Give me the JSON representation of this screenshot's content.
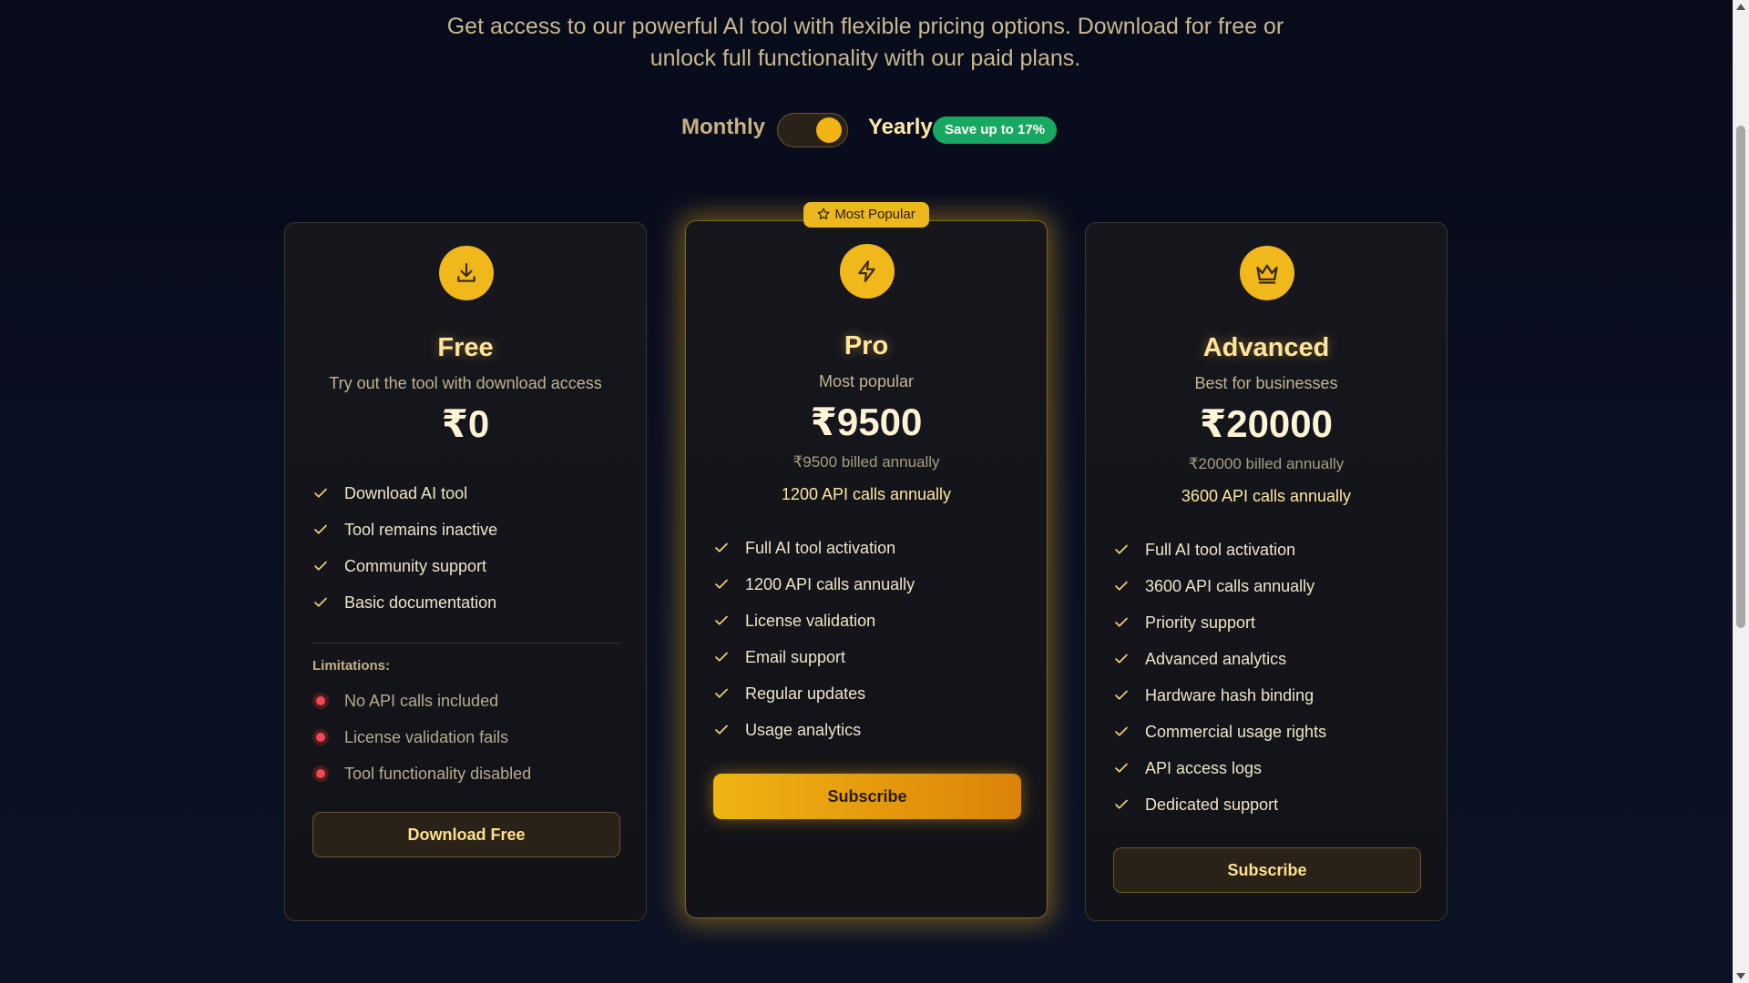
{
  "intro": {
    "line1": "Get access to our powerful AI tool with flexible pricing options. Download for free or",
    "line2": "unlock full functionality with our paid plans."
  },
  "billing": {
    "monthly_label": "Monthly",
    "yearly_label": "Yearly",
    "save_badge": "Save up to 17%",
    "selected": "Yearly"
  },
  "colors": {
    "accent": "#f0b81b",
    "success": "#19a861",
    "danger": "#ef4755"
  },
  "plans": {
    "free": {
      "icon": "download-icon",
      "name": "Free",
      "description": "Try out the tool with download access",
      "price": "₹0",
      "features": [
        "Download AI tool",
        "Tool remains inactive",
        "Community support",
        "Basic documentation"
      ],
      "limitations_title": "Limitations:",
      "limitations": [
        "No API calls included",
        "License validation fails",
        "Tool functionality disabled"
      ],
      "button": "Download Free"
    },
    "pro": {
      "badge": "Most Popular",
      "icon": "lightning-icon",
      "name": "Pro",
      "description": "Most popular",
      "price": "₹9500",
      "billed": "₹9500 billed annually",
      "calls": "1200 API calls annually",
      "features": [
        "Full AI tool activation",
        "1200 API calls annually",
        "License validation",
        "Email support",
        "Regular updates",
        "Usage analytics"
      ],
      "button": "Subscribe"
    },
    "advanced": {
      "icon": "crown-icon",
      "name": "Advanced",
      "description": "Best for businesses",
      "price": "₹20000",
      "billed": "₹20000 billed annually",
      "calls": "3600 API calls annually",
      "features": [
        "Full AI tool activation",
        "3600 API calls annually",
        "Priority support",
        "Advanced analytics",
        "Hardware hash binding",
        "Commercial usage rights",
        "API access logs",
        "Dedicated support"
      ],
      "button": "Subscribe"
    }
  }
}
